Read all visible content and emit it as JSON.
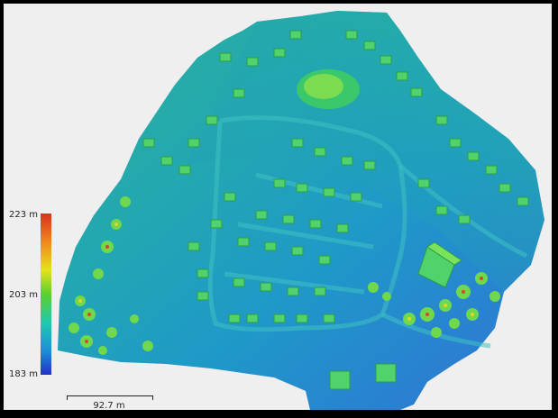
{
  "legend": {
    "max_label": "223 m",
    "mid_label": "203 m",
    "min_label": "183 m",
    "colors": [
      "#d9301f",
      "#f08a1d",
      "#e6e21c",
      "#5ccf2e",
      "#1fc9b0",
      "#1d8fd6",
      "#2432c8"
    ]
  },
  "scale_bar": {
    "label": "92.7 m"
  },
  "map": {
    "background_color": "#efefef",
    "frame_color": "#000000"
  }
}
